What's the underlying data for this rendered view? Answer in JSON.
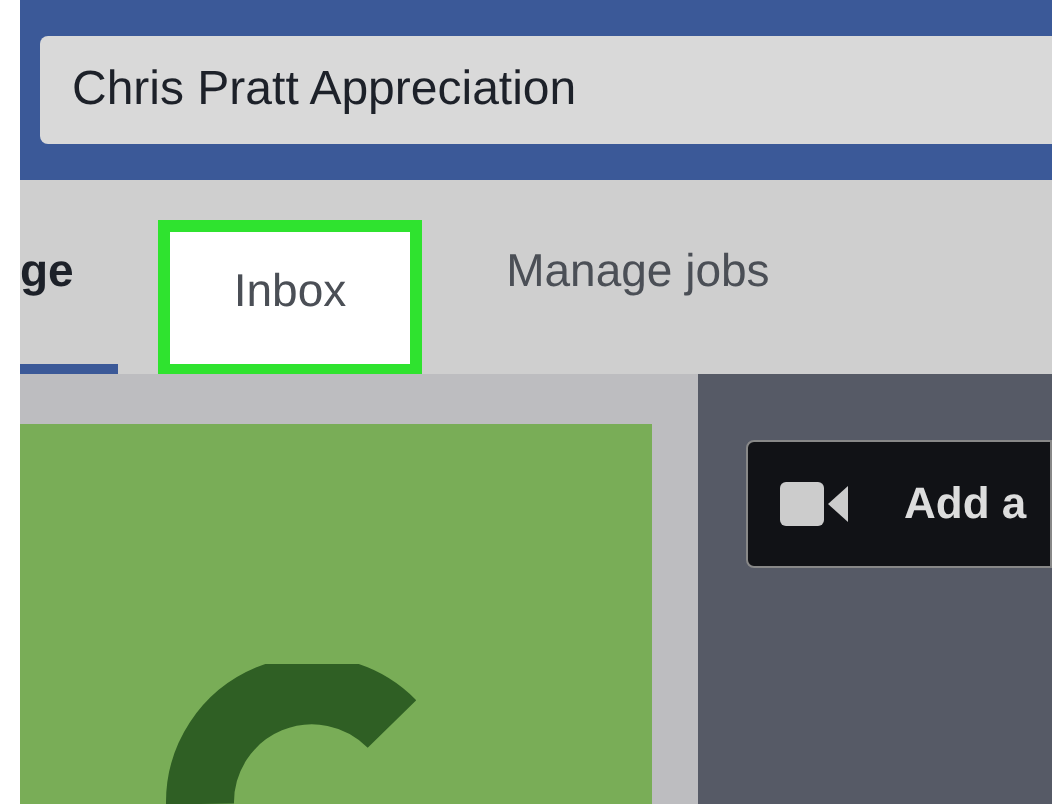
{
  "search": {
    "value": "Chris Pratt Appreciation"
  },
  "tabs": [
    {
      "label": "ge",
      "selected": true,
      "highlighted": false
    },
    {
      "label": "Inbox",
      "selected": false,
      "highlighted": true
    },
    {
      "label": "Manage jobs",
      "selected": false,
      "highlighted": false
    }
  ],
  "cover": {
    "button": "Add a"
  }
}
